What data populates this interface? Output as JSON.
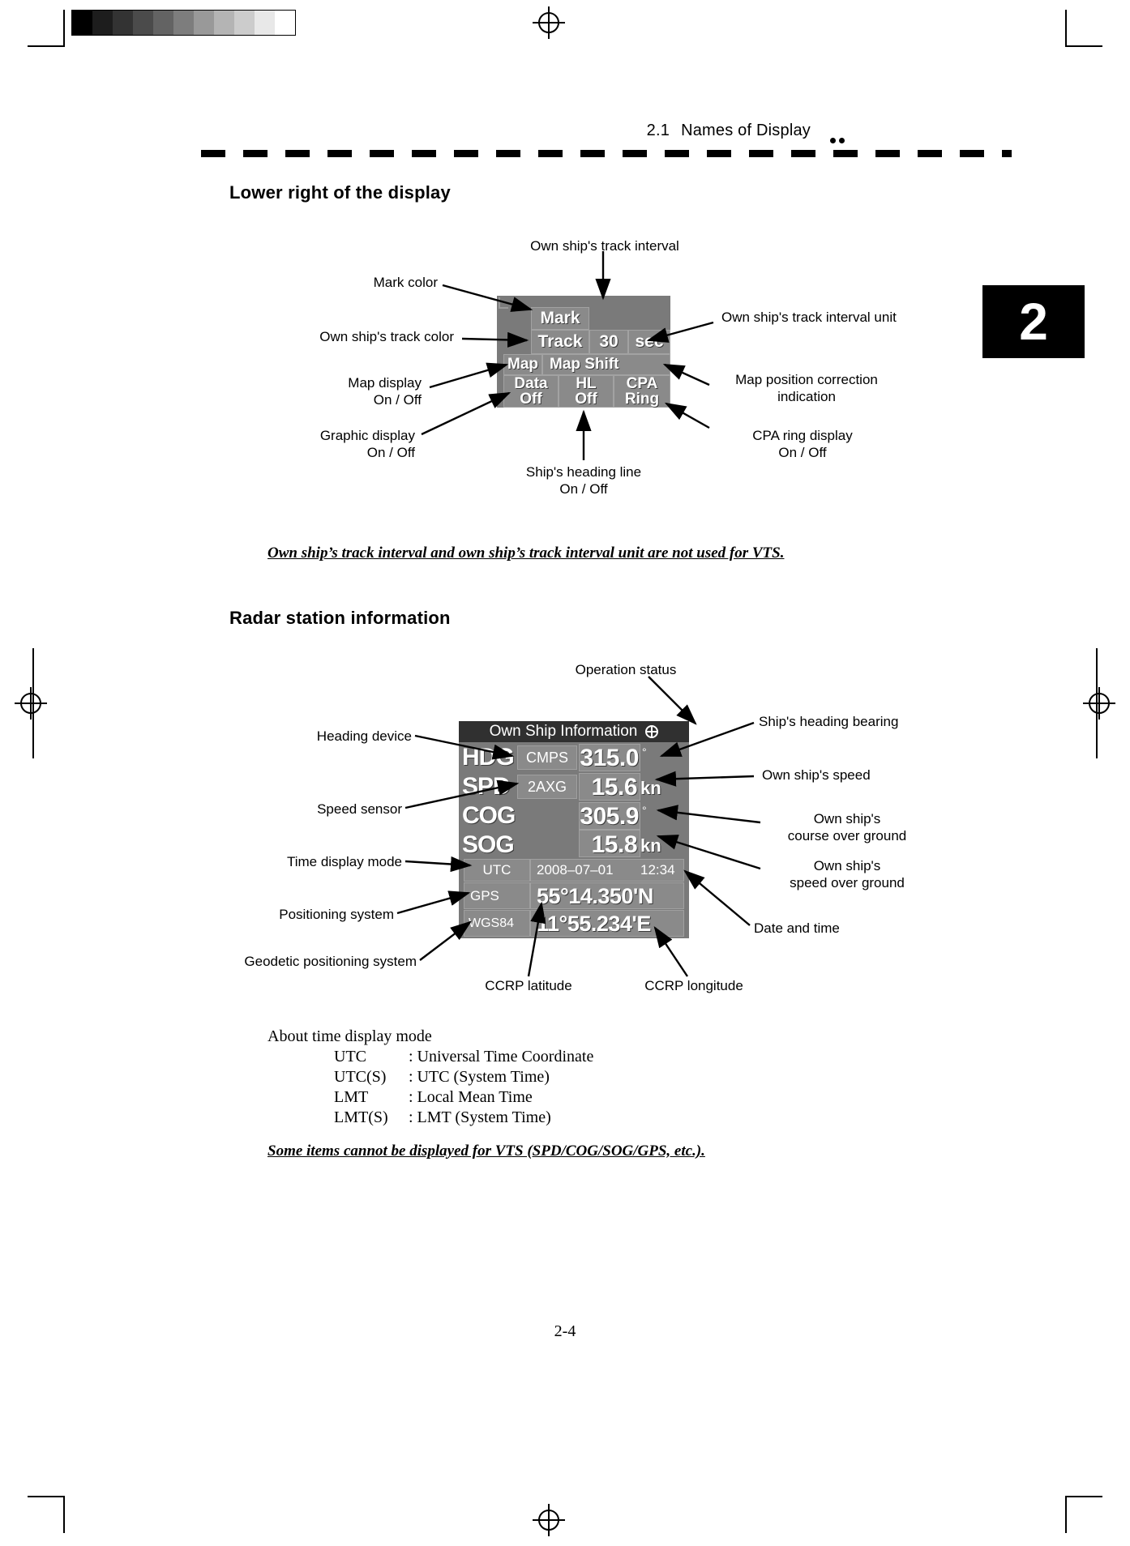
{
  "page": {
    "header": {
      "section_number": "2.1",
      "section_title": "Names of Display",
      "dots": "••"
    },
    "chapter_tab": "2",
    "page_number": "2-4"
  },
  "sections": [
    {
      "heading": "Lower right of the display"
    },
    {
      "heading": "Radar station information"
    }
  ],
  "notes": {
    "note1": "Own ship’s track interval and own ship’s track interval unit are not used for VTS.",
    "note2": "Some items cannot be displayed for VTS (SPD/COG/SOG/GPS, etc.)."
  },
  "time_mode": {
    "title": "About time display mode",
    "rows": [
      {
        "key": "UTC",
        "value": ": Universal Time Coordinate"
      },
      {
        "key": "UTC(S)",
        "value": ": UTC (System Time)"
      },
      {
        "key": "LMT",
        "value": ": Local Mean Time"
      },
      {
        "key": "LMT(S)",
        "value": ": LMT (System Time)"
      }
    ]
  },
  "panel_lower_right": {
    "keys": {
      "mark": "Mark",
      "track": "Track",
      "interval_value": "30",
      "interval_unit": "sec",
      "map": "Map",
      "map_shift": "Map Shift",
      "data_line1": "Data",
      "data_line2": "Off",
      "hl_line1": "HL",
      "hl_line2": "Off",
      "cpa_line1": "CPA",
      "cpa_line2": "Ring"
    },
    "callouts": {
      "track_interval": "Own ship's track interval",
      "mark_color": "Mark color",
      "track_color": "Own ship's track color",
      "map_display": "Map display\nOn / Off",
      "graphic_display": "Graphic display\nOn / Off",
      "heading_line": "Ship's heading line\nOn / Off",
      "interval_unit": "Own ship's track interval unit",
      "map_correction": "Map position correction\nindication",
      "cpa_ring": "CPA ring display\nOn / Off"
    }
  },
  "panel_own_ship": {
    "title": "Own  Ship  Information",
    "title_icon": "compass-icon",
    "rows": [
      {
        "label": "HDG",
        "sensor": "CMPS",
        "value": "315.0",
        "unit": "°"
      },
      {
        "label": "SPD",
        "sensor": "2AXG",
        "value": "15.6",
        "unit": "kn"
      },
      {
        "label": "COG",
        "sensor": "",
        "value": "305.9",
        "unit": "°"
      },
      {
        "label": "SOG",
        "sensor": "",
        "value": "15.8",
        "unit": "kn"
      }
    ],
    "time_mode": "UTC",
    "date": "2008–07–01",
    "time": "12:34",
    "positioning_system": "GPS",
    "latitude": "55°14.350'N",
    "geodetic_system": "WGS84",
    "longitude": "11°55.234'E",
    "callouts": {
      "operation_status": "Operation status",
      "heading_device": "Heading device",
      "speed_sensor": "Speed sensor",
      "time_display_mode": "Time display mode",
      "positioning_system": "Positioning system",
      "geodetic_positioning_system": "Geodetic positioning system",
      "ccrp_latitude": "CCRP latitude",
      "ccrp_longitude": "CCRP longitude",
      "heading_bearing": "Ship's heading bearing",
      "own_ship_speed": "Own ship's speed",
      "course_over_ground": "Own ship's\ncourse over ground",
      "speed_over_ground": "Own ship's\nspeed over ground",
      "date_and_time": "Date and time"
    }
  },
  "grayscale_bar": [
    "#000000",
    "#1d1d1d",
    "#333333",
    "#4b4b4b",
    "#636363",
    "#7d7d7d",
    "#999999",
    "#b4b4b4",
    "#cccccc",
    "#e8e8e8",
    "#ffffff"
  ]
}
